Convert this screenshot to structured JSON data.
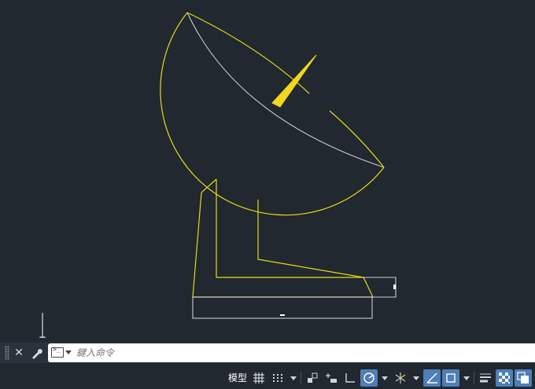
{
  "drawing": {
    "colors": {
      "background": "#212830",
      "dish_outline": "#e6da17",
      "dish_rim": "#c9ced6",
      "feed_horn": "#f2d61f",
      "base_outline": "#e6da17",
      "base_plate": "#c9ced6",
      "crosshair": "#ffffff"
    }
  },
  "command_line": {
    "close_icon": "close-icon",
    "customize_icon": "wrench-icon",
    "prompt_icon": "command-prompt-icon",
    "placeholder": "鍵入命令"
  },
  "status_bar": {
    "model_label": "模型",
    "icons": [
      "grid-icon",
      "snap-icon",
      "infer-constraints-icon",
      "dynamic-input-icon",
      "ortho-icon",
      "polar-tracking-icon",
      "isometric-icon",
      "object-snap-tracking-icon",
      "object-snap-icon",
      "lineweight-icon",
      "transparency-icon",
      "selection-cycling-icon"
    ]
  }
}
